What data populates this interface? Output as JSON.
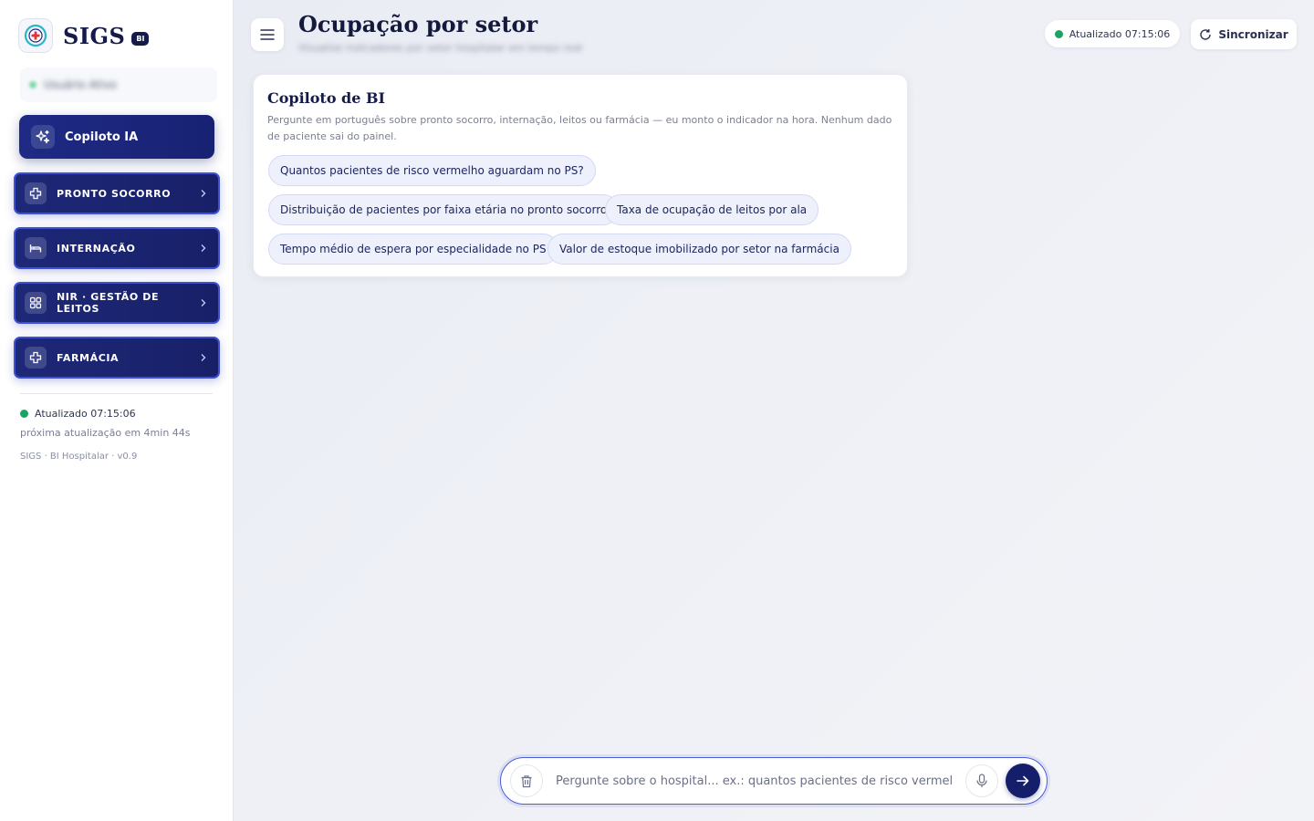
{
  "brand": {
    "name": "SIGS",
    "badge": "BI"
  },
  "user": {
    "name": "Usuário Ativo"
  },
  "copilot": {
    "label": "Copiloto IA",
    "icon": "sparkles-icon"
  },
  "nav": {
    "items": [
      {
        "label": "PRONTO SOCORRO",
        "icon": "medical-cross-icon"
      },
      {
        "label": "INTERNAÇÃO",
        "icon": "bed-icon"
      },
      {
        "label": "NIR · GESTÃO DE LEITOS",
        "icon": "grid-icon"
      },
      {
        "label": "FARMÁCIA",
        "icon": "medical-cross-icon"
      }
    ]
  },
  "sidebar_status": {
    "updated": "Atualizado 07:15:06",
    "next": "próxima atualização em 4min 44s",
    "version": "SIGS · BI Hospitalar · v0.9"
  },
  "header": {
    "title": "Ocupação por setor",
    "subtitle": "Visualize indicadores por setor hospitalar em tempo real",
    "status": "Atualizado 07:15:06",
    "sync_label": "Sincronizar"
  },
  "card": {
    "title": "Copiloto de BI",
    "description": "Pergunte em português sobre pronto socorro, internação, leitos ou farmácia — eu monto o indicador na hora. Nenhum dado de paciente sai do painel.",
    "suggestions": [
      "Quantos pacientes de risco vermelho aguardam no PS?",
      "Distribuição de pacientes por faixa etária no pronto socorro",
      "Taxa de ocupação de leitos por ala",
      "Tempo médio de espera por especialidade no PS",
      "Valor de estoque imobilizado por setor na farmácia"
    ]
  },
  "composer": {
    "placeholder": "Pergunte sobre o hospital... ex.: quantos pacientes de risco vermelho aguardam no PS?",
    "value": ""
  },
  "colors": {
    "brand_navy": "#141a4a",
    "nav_gradient": "#1d2877",
    "nav_border": "#3d50d6",
    "status_green": "#1aa461",
    "chip_bg": "#eef1fb"
  }
}
